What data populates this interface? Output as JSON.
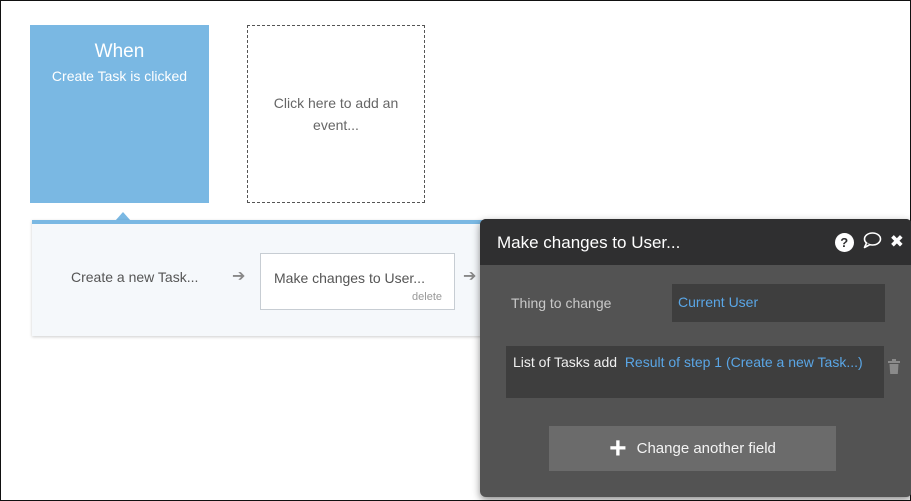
{
  "events": {
    "trigger": {
      "when_label": "When",
      "description": "Create Task is clicked"
    },
    "add_event": {
      "label": "Click here to add an event..."
    }
  },
  "workflow": {
    "steps": [
      {
        "label": "Create a new Task..."
      },
      {
        "label": "Make changes to User...",
        "delete_label": "delete"
      }
    ]
  },
  "panel": {
    "title": "Make changes to User...",
    "icons": [
      "help-icon",
      "comment-icon",
      "close-icon"
    ],
    "thing_to_change": {
      "label": "Thing to change",
      "value": "Current User"
    },
    "fields": [
      {
        "label": "List of Tasks add",
        "value": "Result of step 1 (Create a new Task...)"
      }
    ],
    "change_another_label": "Change another field"
  },
  "colors": {
    "event_blue": "#7ab8e3",
    "panel_bg": "#535353",
    "panel_header": "#2f2f30",
    "link_blue": "#5aa6e6"
  }
}
